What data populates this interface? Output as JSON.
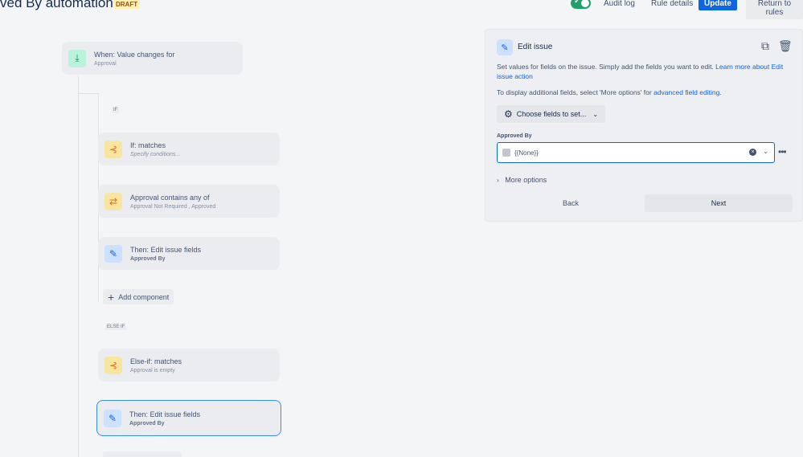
{
  "header": {
    "title": "ved By automation",
    "badge": "DRAFT",
    "audit_log": "Audit log",
    "rule_details": "Rule details",
    "update": "Update",
    "return": "Return to rules"
  },
  "flow": {
    "trigger": {
      "title": "When: Value changes for",
      "subtitle": "Approval"
    },
    "if_tag": "IF",
    "if_card": {
      "title": "If: matches",
      "subtitle": "Specify conditions..."
    },
    "contains_card": {
      "title": "Approval contains any of",
      "subtitle": "Approval Not Required , Approved"
    },
    "then_card": {
      "title": "Then: Edit issue fields",
      "subtitle": "Approved By"
    },
    "add_component": "Add component",
    "else_if_tag": "ELSE IF",
    "elseif_card": {
      "title": "Else-if: matches",
      "subtitle": "Approval is empty"
    },
    "then_card2": {
      "title": "Then: Edit issue fields",
      "subtitle": "Approved By"
    }
  },
  "panel": {
    "title": "Edit issue",
    "desc": "Set values for fields on the issue. Simply add the fields you want to edit.",
    "learn_more": "Learn more about Edit issue action",
    "desc2_prefix": "To display additional fields, select 'More options' for",
    "desc2_link": "advanced field editing",
    "desc2_suffix": ".",
    "choose_fields": "Choose fields to set...",
    "field_label": "Approved By",
    "field_value": "{{None}}",
    "more_options": "More options",
    "back": "Back",
    "next": "Next"
  },
  "colors": {
    "accent": "#0c66e4",
    "toggle": "#22a06b"
  }
}
